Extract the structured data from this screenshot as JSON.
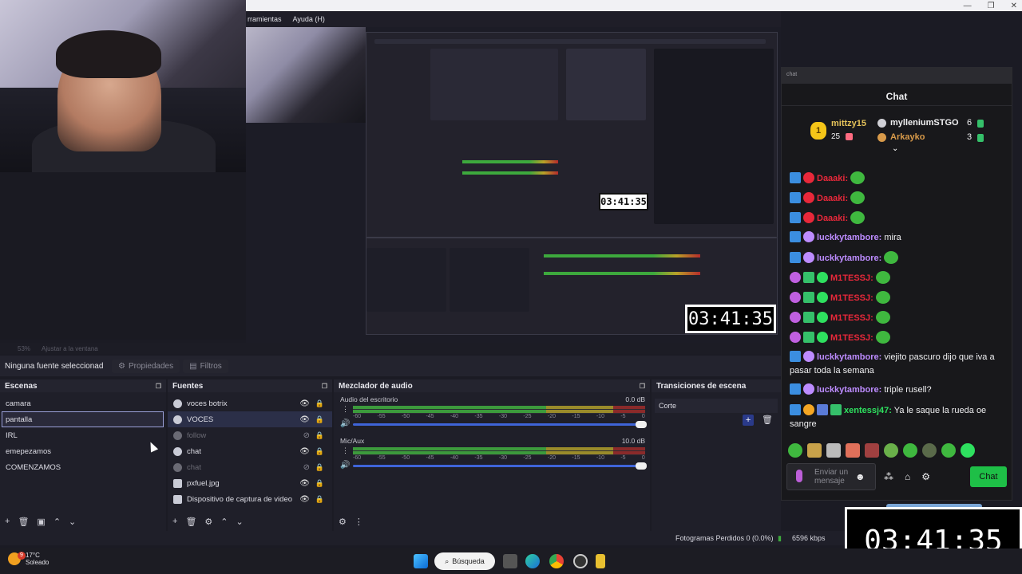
{
  "menu": {
    "items": [
      "rramientas",
      "Ayuda (H)"
    ]
  },
  "window_controls": [
    "—",
    "❐",
    "✕"
  ],
  "preview": {
    "small_timer": "03:41:35",
    "medium_timer": "03:41:35",
    "bottom_items": [
      "53%",
      "Ajustar a la ventana"
    ]
  },
  "properties_bar": {
    "no_source": "Ninguna fuente seleccionad",
    "properties": "Propiedades",
    "filters": "Filtros"
  },
  "scenes": {
    "title": "Escenas",
    "items": [
      "camara",
      "pantalla",
      "IRL",
      "emepezamos",
      "COMENZAMOS"
    ],
    "selected": "pantalla"
  },
  "sources": {
    "title": "Fuentes",
    "items": [
      {
        "name": "voces botrix",
        "visible": true
      },
      {
        "name": "VOCES",
        "visible": true,
        "selected": true
      },
      {
        "name": "follow",
        "visible": false
      },
      {
        "name": "chat",
        "visible": true
      },
      {
        "name": "chat",
        "visible": false
      },
      {
        "name": "pxfuel.jpg",
        "visible": true
      },
      {
        "name": "Dispositivo de captura de video",
        "visible": true
      }
    ]
  },
  "mixer": {
    "title": "Mezclador de audio",
    "channels": [
      {
        "name": "Audio del escritorio",
        "db": "0.0 dB"
      },
      {
        "name": "Mic/Aux",
        "db": "10.0 dB"
      }
    ],
    "ticks": [
      "-60",
      "-55",
      "-50",
      "-45",
      "-40",
      "-35",
      "-30",
      "-25",
      "-20",
      "-15",
      "-10",
      "-5",
      "0"
    ]
  },
  "transitions": {
    "title": "Transiciones de escena",
    "selected": "Corte"
  },
  "chat": {
    "url_placeholder": "chat",
    "title": "Chat",
    "leaderboard": [
      {
        "rank": "1",
        "name": "mittzy15",
        "count": "25"
      },
      {
        "name": "mylleniumSTGO",
        "count": "6"
      },
      {
        "name": "Arkayko",
        "count": "3"
      }
    ],
    "messages": [
      {
        "user": "Daaaki:",
        "text": "",
        "color": "#e8283a"
      },
      {
        "user": "Daaaki:",
        "text": "",
        "color": "#e8283a"
      },
      {
        "user": "Daaaki:",
        "text": "",
        "color": "#e8283a"
      },
      {
        "user": "luckkytambore:",
        "text": "mira",
        "color": "#bd8cff"
      },
      {
        "user": "luckkytambore:",
        "text": "",
        "color": "#bd8cff"
      },
      {
        "user": "M1TESSJ:",
        "text": "",
        "color": "#e8283a"
      },
      {
        "user": "M1TESSJ:",
        "text": "",
        "color": "#e8283a"
      },
      {
        "user": "M1TESSJ:",
        "text": "",
        "color": "#e8283a"
      },
      {
        "user": "M1TESSJ:",
        "text": "",
        "color": "#e8283a"
      },
      {
        "user": "luckkytambore:",
        "text": "viejito pascuro dijo que iva a pasar toda la semana",
        "color": "#bd8cff"
      },
      {
        "user": "luckkytambore:",
        "text": "triple rusell?",
        "color": "#bd8cff"
      },
      {
        "user": "xentessj47:",
        "text": "Ya le saque la rueda oe sangre",
        "color": "#2ee05f"
      }
    ],
    "input_placeholder": "Enviar un mensaje",
    "send_button": "Chat"
  },
  "big_timer": "03:41:35",
  "status": {
    "dropped_frames": "Fotogramas Perdidos 0 (0.0%)",
    "bitrate": "6596 kbps"
  },
  "taskbar": {
    "temperature": "17°C",
    "weather": "Soleado",
    "search": "Búsqueda",
    "weather_badge": "9"
  },
  "colors": {
    "accent_blue": "#3f64d8",
    "twitch_green": "#1ebf47",
    "chat_bg": "#18181b"
  }
}
